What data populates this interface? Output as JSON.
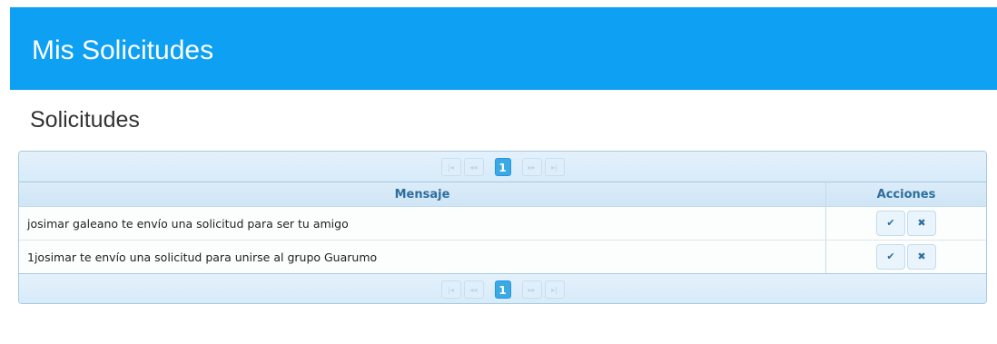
{
  "header": {
    "title": "Mis Solicitudes"
  },
  "section": {
    "title": "Solicitudes"
  },
  "grid": {
    "columns": [
      "Mensaje",
      "Acciones"
    ],
    "rows": [
      {
        "mensaje": "josimar galeano te envío una solicitud para ser tu amigo"
      },
      {
        "mensaje": "1josimar te envío una solicitud para unirse al grupo Guarumo"
      }
    ],
    "pager": {
      "current_page": "1",
      "first_icon": "first-page-icon",
      "prev_icon": "prev-page-icon",
      "next_icon": "next-page-icon",
      "last_icon": "last-page-icon"
    },
    "actions": {
      "accept_icon": "check-icon",
      "reject_icon": "close-icon"
    }
  },
  "colors": {
    "header_bg": "#0ea0f3",
    "grid_border": "#a6c9e2",
    "header_text": "#2e6e9e"
  }
}
